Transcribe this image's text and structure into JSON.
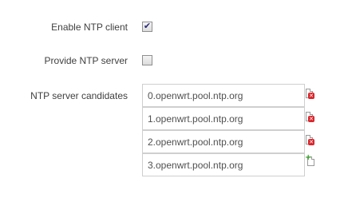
{
  "fields": {
    "enable_ntp_client": {
      "label": "Enable NTP client",
      "checked": true,
      "check_glyph": "✔"
    },
    "provide_ntp_server": {
      "label": "Provide NTP server",
      "checked": false
    },
    "ntp_server_candidates": {
      "label": "NTP server candidates",
      "servers": [
        {
          "value": "0.openwrt.pool.ntp.org",
          "action": "remove",
          "action_icon": "remove-entry-icon",
          "action_symbol": "✕"
        },
        {
          "value": "1.openwrt.pool.ntp.org",
          "action": "remove",
          "action_icon": "remove-entry-icon",
          "action_symbol": "✕"
        },
        {
          "value": "2.openwrt.pool.ntp.org",
          "action": "remove",
          "action_icon": "remove-entry-icon",
          "action_symbol": "✕"
        },
        {
          "value": "3.openwrt.pool.ntp.org",
          "action": "add",
          "action_icon": "add-entry-icon",
          "action_symbol": "+"
        }
      ]
    }
  },
  "colors": {
    "label_text": "#404040",
    "input_border": "#cfcfcf",
    "remove_badge": "#d9262c",
    "add_badge": "#2ea11f"
  }
}
